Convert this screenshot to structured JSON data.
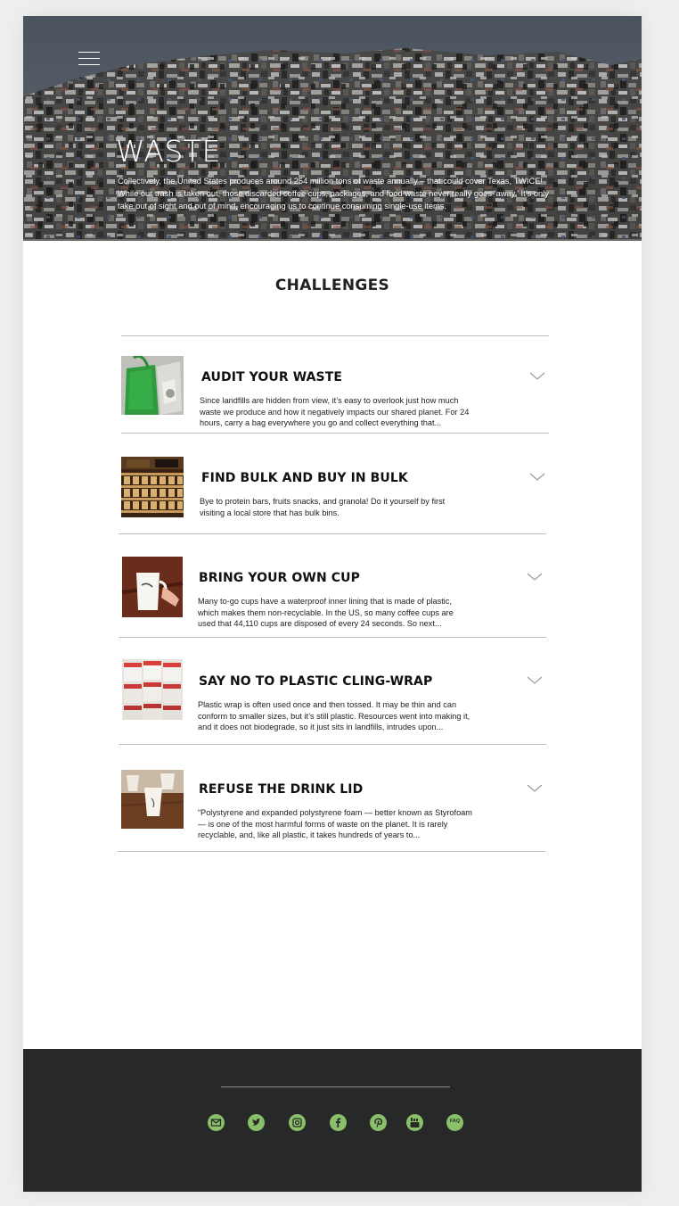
{
  "hero": {
    "title": "WASTE",
    "text": "Collectively, the United States produces around 254 million tons of waste annually – that could cover Texas, TWICE! While our trash is taken out, those discarded coffee cups, packages, and food waste never really goes ‘away.’ It’s only take out of sight and out of mind, encouraging us to continue consuming single-use items."
  },
  "challenges": {
    "title": "CHALLENGES",
    "items": [
      {
        "title": "AUDIT YOUR WASTE",
        "desc": "Since landfills are hidden from view, it’s easy to overlook just how much waste we produce and how it negatively impacts our shared planet. For 24 hours, carry a bag everywhere you go and collect everything that..."
      },
      {
        "title": "FIND BULK AND BUY IN BULK",
        "desc": "Bye to protein bars, fruits snacks, and granola! Do it yourself by first visiting a local store that has bulk bins."
      },
      {
        "title": "BRING YOUR OWN CUP",
        "desc": "Many to-go cups have a waterproof inner lining that is made of plastic, which makes them non-recyclable. In the US, so many coffee cups are used that 44,110 cups are disposed of every 24 seconds. So next..."
      },
      {
        "title": "SAY NO TO PLASTIC CLING-WRAP",
        "desc": "Plastic wrap is often used once and then tossed. It may be thin and can conform to smaller sizes, but it’s still plastic. Resources went into making it, and it does not biodegrade, so it just sits in landfills, intrudes upon..."
      },
      {
        "title": "REFUSE THE DRINK LID",
        "desc": "“Polystyrene and expanded polystyrene foam — better known as Styrofoam — is one of the most harmful forms of waste on the planet. It is rarely recyclable, and, like all plastic, it takes hundreds of years to..."
      }
    ]
  },
  "footer": {
    "social": [
      "mail-icon",
      "twitter-icon",
      "instagram-icon",
      "facebook-icon",
      "pinterest-icon",
      "youtube-icon",
      "faq-icon"
    ],
    "faq_label": "FAQ",
    "accent": "#8bc06a",
    "background": "#272828"
  }
}
